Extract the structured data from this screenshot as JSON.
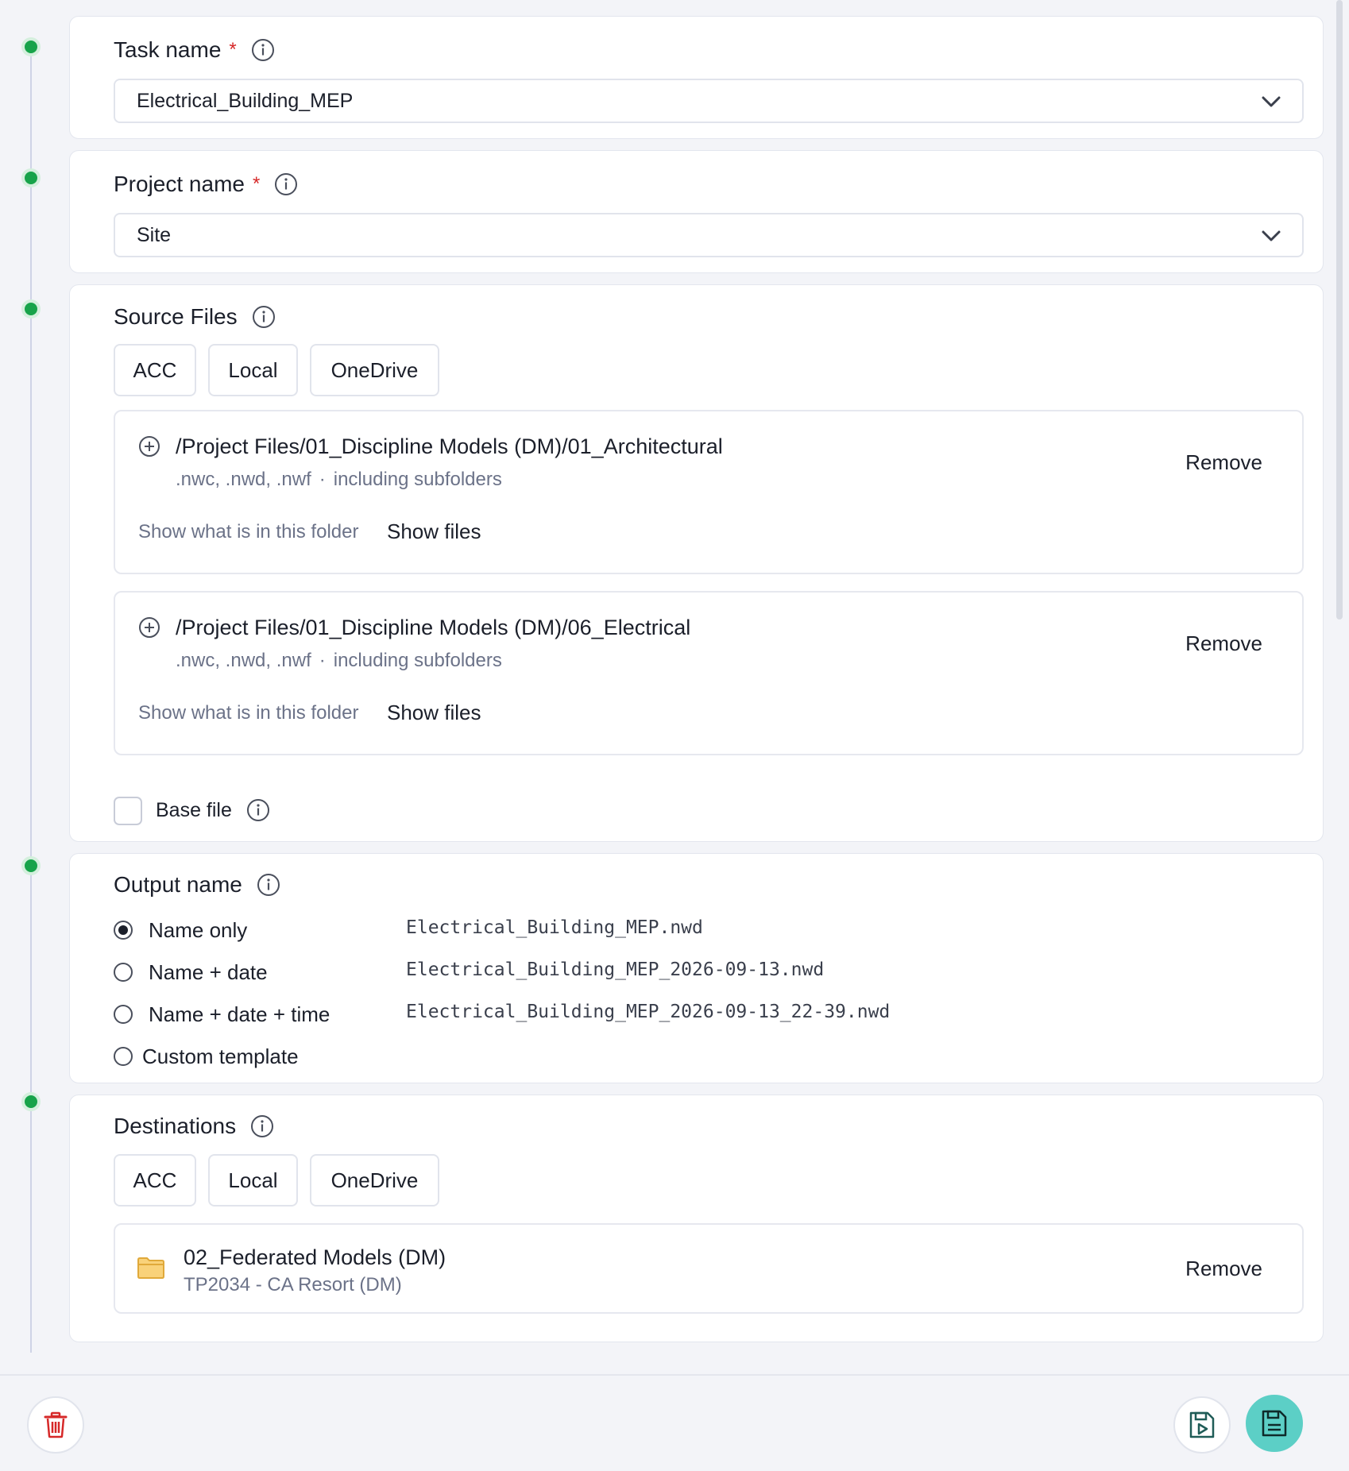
{
  "task": {
    "label": "Task name",
    "required_mark": "*",
    "value": "Electrical_Building_MEP"
  },
  "project": {
    "label": "Project name",
    "required_mark": "*",
    "value": "Site"
  },
  "source_files": {
    "label": "Source Files",
    "buttons": [
      "ACC",
      "Local",
      "OneDrive"
    ],
    "folders": [
      {
        "path": "/Project Files/01_Discipline Models (DM)/01_Architectural",
        "extensions": ".nwc, .nwd, .nwf",
        "separator": "·",
        "scope": "including subfolders",
        "show_what": "Show what is in this folder",
        "show_files": "Show files",
        "remove": "Remove"
      },
      {
        "path": "/Project Files/01_Discipline Models (DM)/06_Electrical",
        "extensions": ".nwc, .nwd, .nwf",
        "separator": "·",
        "scope": "including subfolders",
        "show_what": "Show what is in this folder",
        "show_files": "Show files",
        "remove": "Remove"
      }
    ],
    "base_file_label": "Base file",
    "base_file_checked": false
  },
  "output_name": {
    "label": "Output name",
    "selected": "Name only",
    "options": [
      {
        "label": "Name only",
        "preview": "Electrical_Building_MEP.nwd"
      },
      {
        "label": "Name + date",
        "preview": "Electrical_Building_MEP_2026-09-13.nwd"
      },
      {
        "label": "Name + date + time",
        "preview": "Electrical_Building_MEP_2026-09-13_22-39.nwd"
      },
      {
        "label": "Custom template",
        "preview": ""
      }
    ]
  },
  "destinations": {
    "label": "Destinations",
    "buttons": [
      "ACC",
      "Local",
      "OneDrive"
    ],
    "items": [
      {
        "name": "02_Federated Models (DM)",
        "project": "TP2034 - CA Resort (DM)",
        "remove": "Remove",
        "icon": "folder-icon"
      }
    ]
  },
  "footer": {
    "delete_icon": "trash-icon",
    "save_run_icon": "save-run-icon",
    "save_icon": "save-icon"
  },
  "colors": {
    "accent_green": "#17a34a",
    "danger": "#d62828",
    "primary_save_bg": "#5ccfc6",
    "folder_yellow": "#f4b942"
  }
}
